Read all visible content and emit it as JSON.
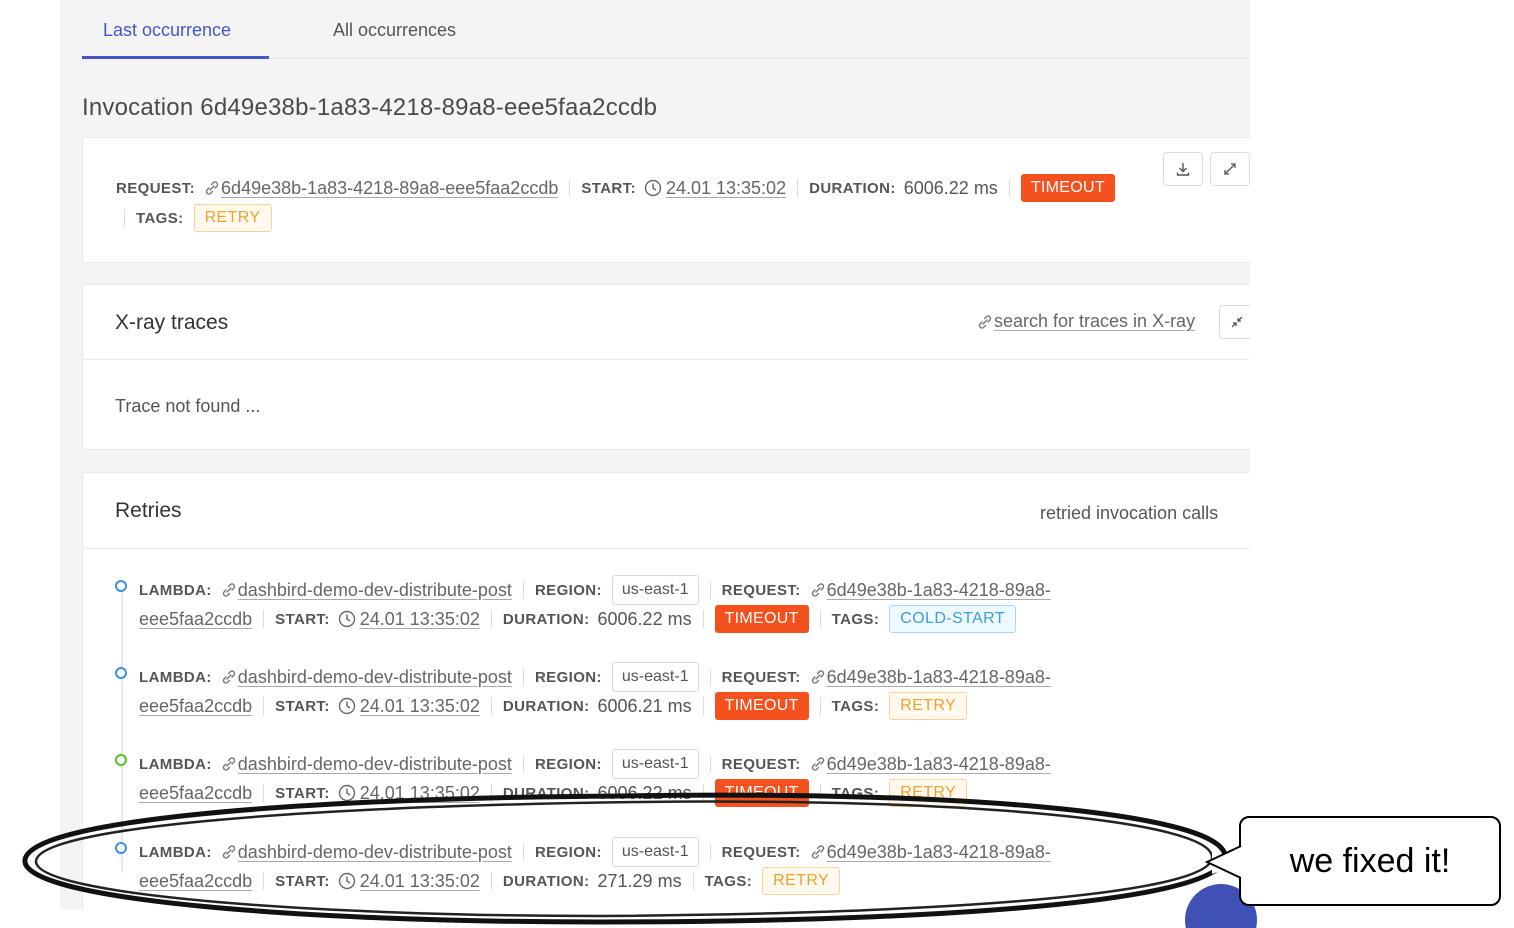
{
  "tabs": [
    {
      "label": "Last occurrence",
      "active": true
    },
    {
      "label": "All occurrences",
      "active": false
    }
  ],
  "invocation_title": "Invocation 6d49e38b-1a83-4218-89a8-eee5faa2ccdb",
  "summary": {
    "request_label": "REQUEST:",
    "request_id": "6d49e38b-1a83-4218-89a8-eee5faa2ccdb",
    "start_label": "START:",
    "start": "24.01 13:35:02",
    "duration_label": "DURATION:",
    "duration": "6006.22 ms",
    "status_badge": "TIMEOUT",
    "tags_label": "TAGS:",
    "tag": "RETRY",
    "icons": [
      "download-icon",
      "expand-icon"
    ]
  },
  "xray": {
    "title": "X-ray traces",
    "search_link": "search for traces in X-ray",
    "empty_text": "Trace not found ..."
  },
  "retries": {
    "title": "Retries",
    "subtitle": "retried invocation calls",
    "labels": {
      "lambda": "LAMBDA:",
      "region": "REGION:",
      "request": "REQUEST:",
      "start": "START:",
      "duration": "DURATION:",
      "tags": "TAGS:"
    },
    "items": [
      {
        "lambda": "dashbird-demo-dev-distribute-post",
        "region": "us-east-1",
        "request_part1": "6d49e38b-1a83-4218-89a8-",
        "request_part2": "eee5faa2ccdb",
        "start": "24.01 13:35:02",
        "duration": "6006.22 ms",
        "status": "TIMEOUT",
        "tag": "COLD-START",
        "dot_color": "#3a8ee6"
      },
      {
        "lambda": "dashbird-demo-dev-distribute-post",
        "region": "us-east-1",
        "request_part1": "6d49e38b-1a83-4218-89a8-",
        "request_part2": "eee5faa2ccdb",
        "start": "24.01 13:35:02",
        "duration": "6006.21 ms",
        "status": "TIMEOUT",
        "tag": "RETRY",
        "dot_color": "#3a8ee6"
      },
      {
        "lambda": "dashbird-demo-dev-distribute-post",
        "region": "us-east-1",
        "request_part1": "6d49e38b-1a83-4218-89a8-",
        "request_part2": "eee5faa2ccdb",
        "start": "24.01 13:35:02",
        "duration": "6006.22 ms",
        "status": "TIMEOUT",
        "tag": "RETRY",
        "dot_color": "#52c41a"
      },
      {
        "lambda": "dashbird-demo-dev-distribute-post",
        "region": "us-east-1",
        "request_part1": "6d49e38b-1a83-4218-89a8-",
        "request_part2": "eee5faa2ccdb",
        "start": "24.01 13:35:02",
        "duration": "271.29 ms",
        "status": "",
        "tag": "RETRY",
        "dot_color": "#3a8ee6"
      }
    ]
  },
  "annotation": {
    "callout_text": "we fixed it!"
  },
  "colors": {
    "accent": "#4457c9",
    "timeout": "#f4511e",
    "retry": "#f0a131",
    "cold_start": "#3aa0e0"
  }
}
